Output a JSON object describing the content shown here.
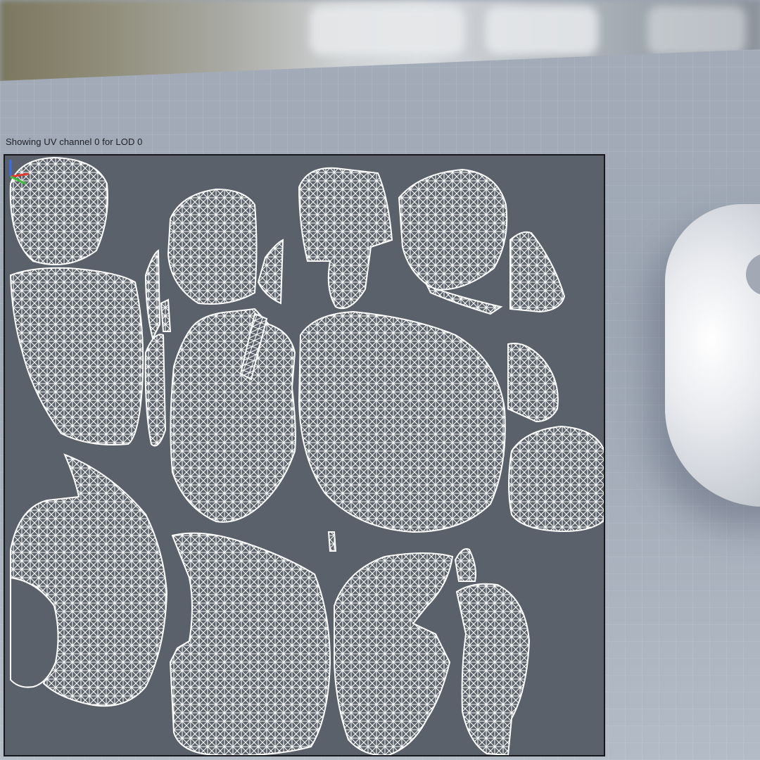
{
  "viewport": {
    "uv_overlay": {
      "caption": "Showing UV channel 0 for LOD 0",
      "channel": 0,
      "lod": 0
    },
    "icons": {
      "axis_gizmo": "axis-gizmo-icon"
    },
    "colors": {
      "uv_background": "#5b616b",
      "uv_wire": "#ffffff",
      "panel_border": "#16181c",
      "axis_x": "#e23b2e",
      "axis_y": "#3fbf3f",
      "axis_z": "#3a6cf0"
    }
  }
}
